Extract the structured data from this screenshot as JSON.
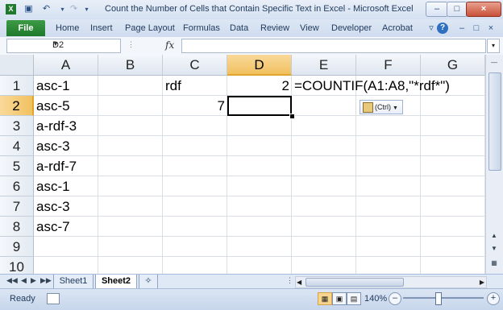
{
  "window": {
    "title": "Count the Number of Cells that Contain Specific Text in Excel - Microsoft Excel",
    "controls": [
      "–",
      "□",
      "×"
    ]
  },
  "ribbon": {
    "file_label": "File",
    "tabs": [
      "Home",
      "Insert",
      "Page Layout",
      "Formulas",
      "Data",
      "Review",
      "View",
      "Developer",
      "Acrobat"
    ]
  },
  "formula_bar": {
    "name_box": "D2",
    "fx_label": "fx",
    "formula": ""
  },
  "grid": {
    "columns": [
      "A",
      "B",
      "C",
      "D",
      "E",
      "F",
      "G"
    ],
    "rows": [
      "1",
      "2",
      "3",
      "4",
      "5",
      "6",
      "7",
      "8",
      "9",
      "10"
    ],
    "selected_column": "D",
    "selected_row": "2",
    "cells": {
      "A1": "asc-1",
      "A2": "asc-5",
      "A3": "a-rdf-3",
      "A4": "asc-3",
      "A5": "a-rdf-7",
      "A6": "asc-1",
      "A7": "asc-3",
      "A8": "asc-7",
      "C1": "rdf",
      "C2": "7",
      "D1": "2",
      "E1": "=COUNTIF(A1:A8,\"*rdf*\")"
    },
    "paste_options_label": "(Ctrl)"
  },
  "sheets": {
    "tabs": [
      "Sheet1",
      "Sheet2"
    ],
    "active": "Sheet2"
  },
  "status_bar": {
    "mode": "Ready",
    "zoom": "140%"
  }
}
